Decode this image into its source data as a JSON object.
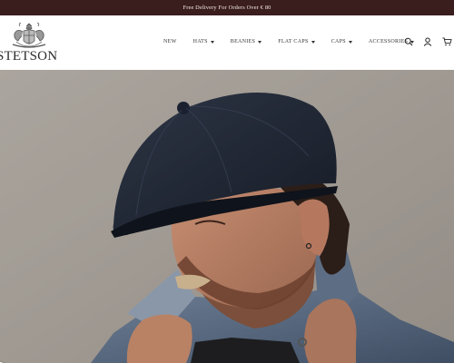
{
  "announcement": {
    "text": "Free Delivery For Orders Over € 80"
  },
  "brand": {
    "name": "STETSON"
  },
  "nav": {
    "items": [
      {
        "label": "NEW",
        "dropdown": false
      },
      {
        "label": "HATS",
        "dropdown": true
      },
      {
        "label": "BEANIES",
        "dropdown": true
      },
      {
        "label": "FLAT CAPS",
        "dropdown": true
      },
      {
        "label": "CAPS",
        "dropdown": true
      },
      {
        "label": "ACCESSORIES",
        "dropdown": true
      }
    ]
  },
  "header_icons": [
    "search-icon",
    "account-icon",
    "cart-icon"
  ],
  "colors": {
    "announcement_bg": "#3a1d1d",
    "announcement_text": "#f3ece6",
    "hero_bg": "#a49f98"
  }
}
